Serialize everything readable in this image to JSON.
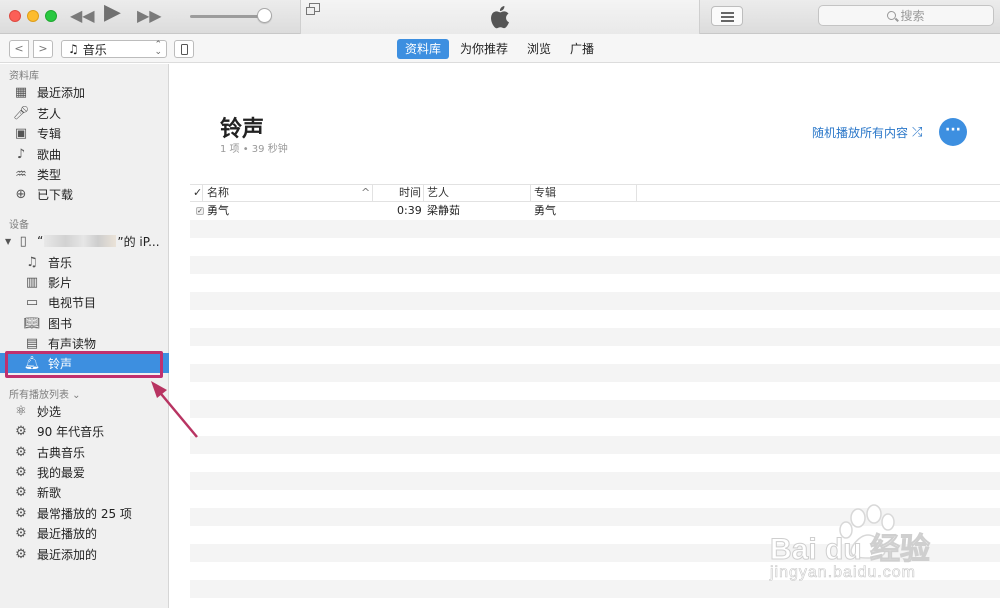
{
  "search": {
    "placeholder": "搜索"
  },
  "nav": {
    "media_type": "音乐",
    "tabs": [
      {
        "label": "资料库",
        "active": true
      },
      {
        "label": "为你推荐",
        "active": false
      },
      {
        "label": "浏览",
        "active": false
      },
      {
        "label": "广播",
        "active": false
      }
    ]
  },
  "sidebar": {
    "library_header": "资料库",
    "library_items": [
      {
        "label": "最近添加",
        "icon": "grid-icon"
      },
      {
        "label": "艺人",
        "icon": "microphone-icon"
      },
      {
        "label": "专辑",
        "icon": "album-icon"
      },
      {
        "label": "歌曲",
        "icon": "music-note-icon"
      },
      {
        "label": "类型",
        "icon": "genre-icon"
      },
      {
        "label": "已下载",
        "icon": "download-icon"
      }
    ],
    "devices_header": "设备",
    "device_name_prefix": "“",
    "device_name_suffix": "”的 iP...",
    "device_items": [
      {
        "label": "音乐",
        "icon": "music-note-icon"
      },
      {
        "label": "影片",
        "icon": "film-icon"
      },
      {
        "label": "电视节目",
        "icon": "tv-icon"
      },
      {
        "label": "图书",
        "icon": "book-icon"
      },
      {
        "label": "有声读物",
        "icon": "audiobook-icon"
      },
      {
        "label": "铃声",
        "icon": "bell-icon",
        "selected": true
      }
    ],
    "playlists_header": "所有播放列表 ⌄",
    "playlist_items": [
      {
        "label": "妙选",
        "icon": "atom-icon"
      },
      {
        "label": "90 年代音乐",
        "icon": "gear-icon"
      },
      {
        "label": "古典音乐",
        "icon": "gear-icon"
      },
      {
        "label": "我的最爱",
        "icon": "gear-icon"
      },
      {
        "label": "新歌",
        "icon": "gear-icon"
      },
      {
        "label": "最常播放的 25 项",
        "icon": "gear-icon"
      },
      {
        "label": "最近播放的",
        "icon": "gear-icon"
      },
      {
        "label": "最近添加的",
        "icon": "gear-icon"
      }
    ]
  },
  "main": {
    "title": "铃声",
    "subtitle": "1 项 • 39 秒钟",
    "shuffle_label": "随机播放所有内容",
    "more_label": "···",
    "columns": {
      "check": "✓",
      "name": "名称",
      "sort_arrow": "^",
      "time": "时间",
      "artist": "艺人",
      "album": "专辑"
    },
    "rows": [
      {
        "checked": "✓",
        "name": "勇气",
        "time": "0:39",
        "artist": "梁静茹",
        "album": "勇气"
      }
    ]
  },
  "watermark": {
    "brand": "Bai du 经验",
    "url": "jingyan.baidu.com"
  },
  "colors": {
    "accent": "#3d8fe0",
    "highlight_box": "#c0306e",
    "link": "#2a77c9"
  }
}
